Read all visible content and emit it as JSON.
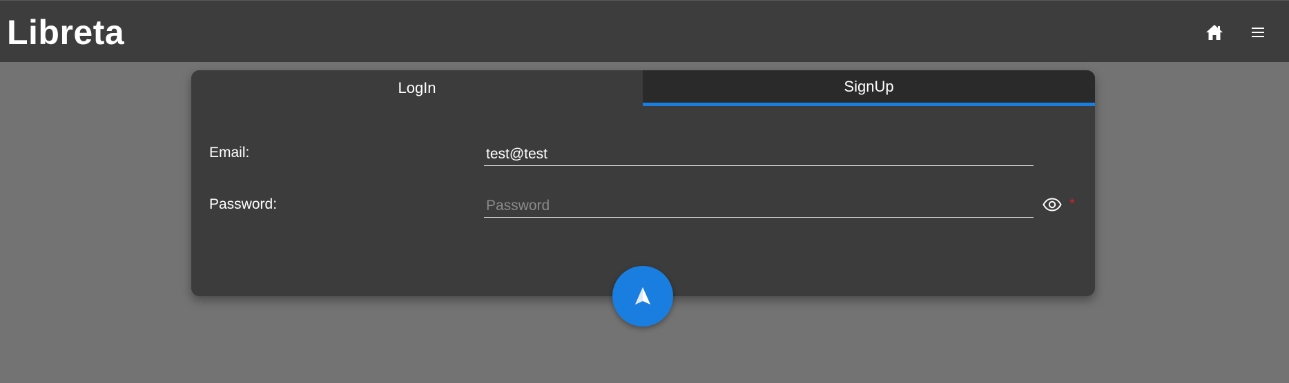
{
  "header": {
    "app_title": "Libreta",
    "home_icon": "home-icon",
    "menu_icon": "menu-icon"
  },
  "tabs": [
    {
      "label": "LogIn",
      "active": false
    },
    {
      "label": "SignUp",
      "active": true
    }
  ],
  "form": {
    "email_label": "Email:",
    "email_value": "test@test",
    "password_label": "Password:",
    "password_placeholder": "Password",
    "password_value": "",
    "required_mark": "*",
    "toggle_visibility_icon": "eye-icon"
  },
  "submit": {
    "icon": "send-icon"
  },
  "colors": {
    "accent": "#1a7ee0",
    "topbar": "#3d3d3d",
    "card": "#3c3c3c",
    "background": "#737373",
    "required": "#e02020"
  }
}
